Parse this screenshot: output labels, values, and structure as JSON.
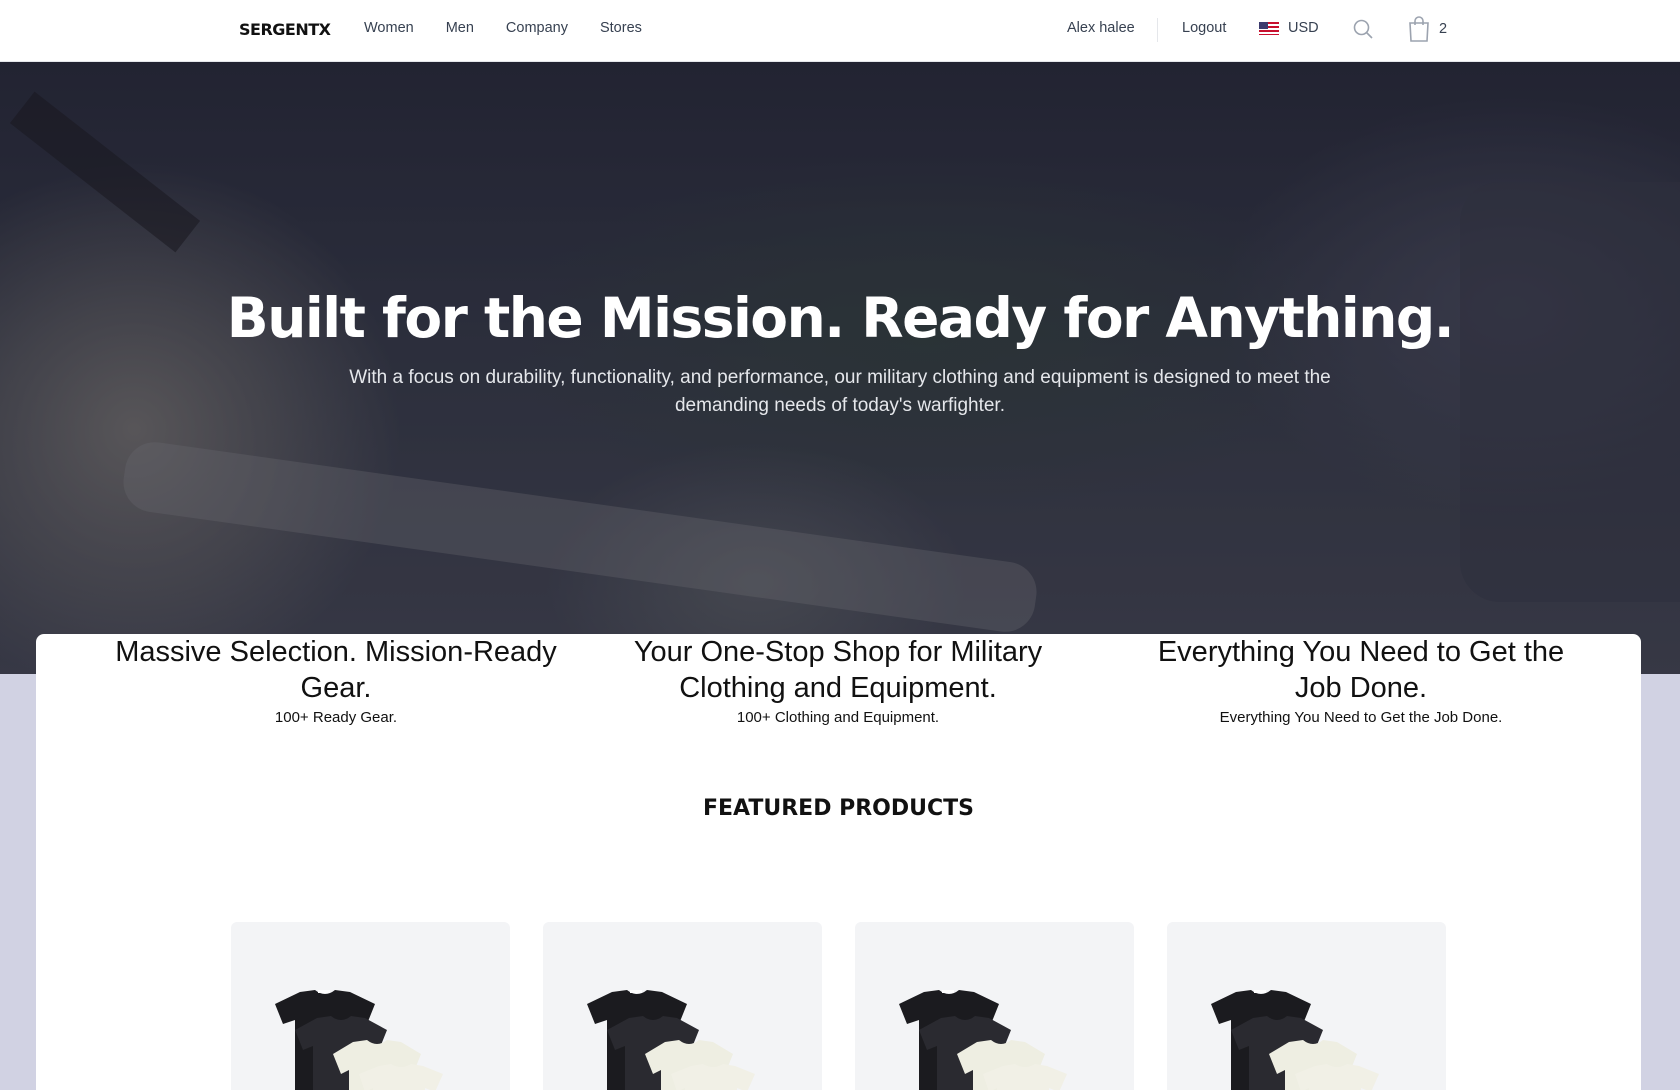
{
  "nav": {
    "logo": "SERGENTX",
    "links": [
      "Women",
      "Men",
      "Company",
      "Stores"
    ],
    "user_name": "Alex halee",
    "logout_label": "Logout",
    "currency": "USD",
    "cart_count": "2"
  },
  "hero": {
    "title": "Built for the Mission. Ready for Anything.",
    "subtitle": "With a focus on durability, functionality, and performance, our military clothing and equipment is designed to meet the demanding needs of today's warfighter."
  },
  "features": [
    {
      "title": "Massive Selection. Mission-Ready Gear.",
      "subtitle": "100+ Ready Gear."
    },
    {
      "title": "Your One-Stop Shop for Military Clothing and Equipment.",
      "subtitle": "100+ Clothing and Equipment."
    },
    {
      "title": "Everything You Need to Get the Job Done.",
      "subtitle": "Everything You Need to Get the Job Done."
    }
  ],
  "featured_heading": "FEATURED PRODUCTS",
  "icons": {
    "search": "search-icon",
    "cart": "shopping-bag-icon",
    "flag": "us-flag-icon"
  },
  "colors": {
    "page_background": "#d1d2e3",
    "text_primary": "#111111",
    "nav_text": "#374151"
  }
}
